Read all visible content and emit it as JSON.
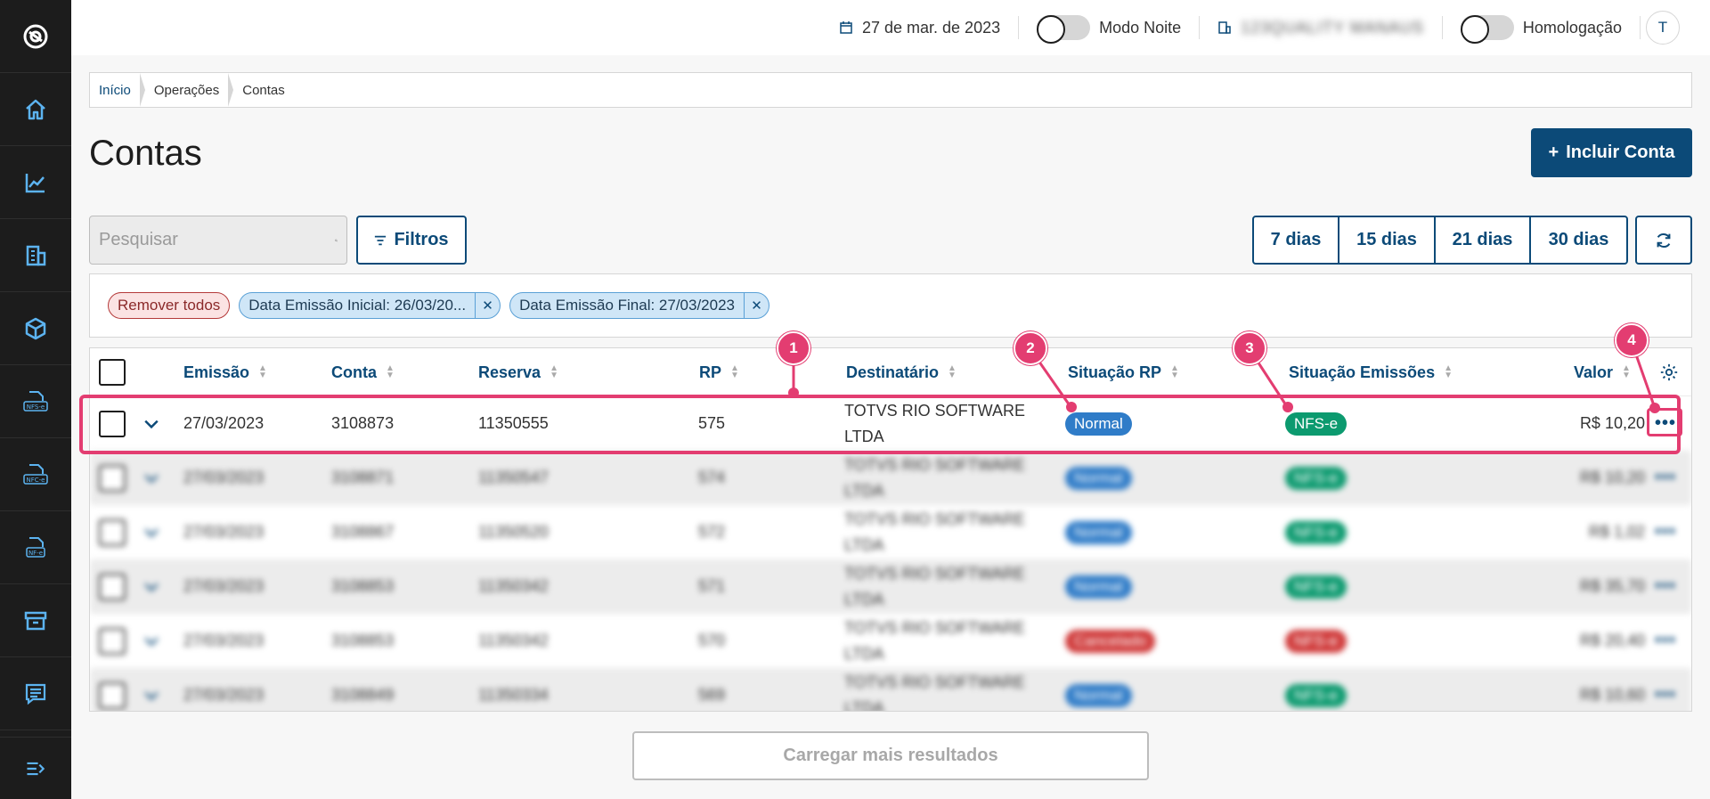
{
  "topbar": {
    "date": "27 de mar. de 2023",
    "night_mode_label": "Modo Noite",
    "company": "123QUALITY MANAUS",
    "homolog_label": "Homologação",
    "avatar_initial": "T"
  },
  "breadcrumb": [
    "Início",
    "Operações",
    "Contas"
  ],
  "page": {
    "title": "Contas",
    "add_button": "Incluir Conta"
  },
  "search": {
    "placeholder": "Pesquisar"
  },
  "filters_button": "Filtros",
  "day_buttons": [
    "7 dias",
    "15 dias",
    "21 dias",
    "30 dias"
  ],
  "chips": {
    "remove_all": "Remover todos",
    "items": [
      "Data Emissão Inicial: 26/03/20...",
      "Data Emissão Final: 27/03/2023"
    ]
  },
  "table": {
    "columns": [
      "Emissão",
      "Conta",
      "Reserva",
      "RP",
      "Destinatário",
      "Situação RP",
      "Situação Emissões",
      "Valor"
    ],
    "rows": [
      {
        "emissao": "27/03/2023",
        "conta": "3108873",
        "reserva": "11350555",
        "rp": "575",
        "destinatario_l1": "TOTVS RIO SOFTWARE",
        "destinatario_l2": "LTDA",
        "situacao_rp": "Normal",
        "situacao_emissoes": "NFS-e",
        "valor": "R$ 10,20"
      },
      {
        "emissao": "27/03/2023",
        "conta": "3108871",
        "reserva": "11350547",
        "rp": "574",
        "destinatario_l1": "TOTVS RIO SOFTWARE",
        "destinatario_l2": "LTDA",
        "situacao_rp": "Normal",
        "situacao_emissoes": "NFS-e",
        "valor": "R$ 10,20"
      },
      {
        "emissao": "27/03/2023",
        "conta": "3108867",
        "reserva": "11350520",
        "rp": "572",
        "destinatario_l1": "TOTVS RIO SOFTWARE",
        "destinatario_l2": "LTDA",
        "situacao_rp": "Normal",
        "situacao_emissoes": "NFS-e",
        "valor": "R$ 1,02"
      },
      {
        "emissao": "27/03/2023",
        "conta": "3108853",
        "reserva": "11350342",
        "rp": "571",
        "destinatario_l1": "TOTVS RIO SOFTWARE",
        "destinatario_l2": "LTDA",
        "situacao_rp": "Normal",
        "situacao_emissoes": "NFS-e",
        "valor": "R$ 35,70"
      },
      {
        "emissao": "27/03/2023",
        "conta": "3108853",
        "reserva": "11350342",
        "rp": "570",
        "destinatario_l1": "TOTVS RIO SOFTWARE",
        "destinatario_l2": "LTDA",
        "situacao_rp": "Cancelado",
        "situacao_emissoes": "NFS-e",
        "valor": "R$ 20,40"
      },
      {
        "emissao": "27/03/2023",
        "conta": "3108849",
        "reserva": "11350334",
        "rp": "569",
        "destinatario_l1": "TOTVS RIO SOFTWARE",
        "destinatario_l2": "LTDA",
        "situacao_rp": "Normal",
        "situacao_emissoes": "NFS-e",
        "valor": "R$ 10,60"
      }
    ]
  },
  "load_more": "Carregar mais resultados",
  "markers": [
    "1",
    "2",
    "3",
    "4"
  ],
  "colors": {
    "primary": "#0c4a78",
    "annotation": "#e33d71",
    "tag_blue": "#2f7cc8",
    "tag_green": "#0c9a6f"
  },
  "sidebar_icons": [
    "logo-icon",
    "home-icon",
    "chart-icon",
    "building-icon",
    "cube-icon",
    "nfse-icon",
    "nfce-icon",
    "nfe-icon",
    "archive-icon",
    "receipt-icon",
    "collapse-icon"
  ]
}
